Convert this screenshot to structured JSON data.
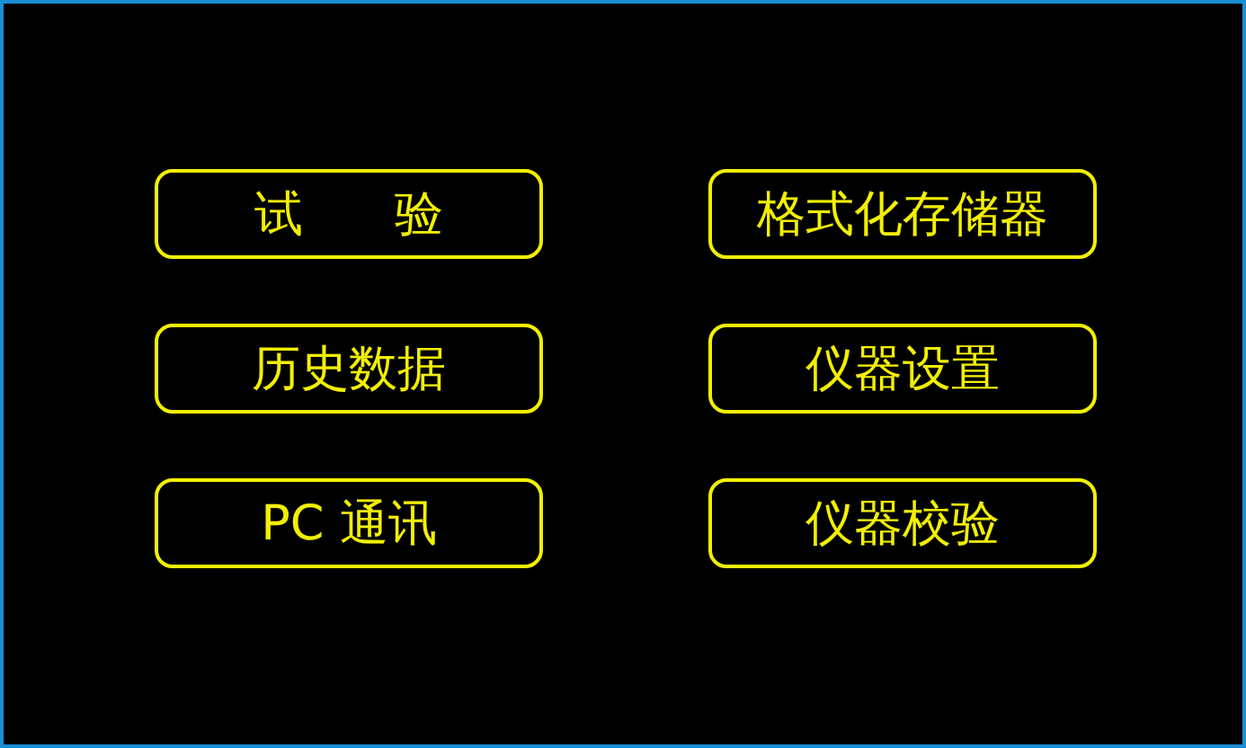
{
  "menu_buttons": [
    {
      "label": "试      验"
    },
    {
      "label": "格式化存储器"
    },
    {
      "label": "历史数据"
    },
    {
      "label": "仪器设置"
    },
    {
      "label": "PC 通讯"
    },
    {
      "label": "仪器校验"
    }
  ]
}
